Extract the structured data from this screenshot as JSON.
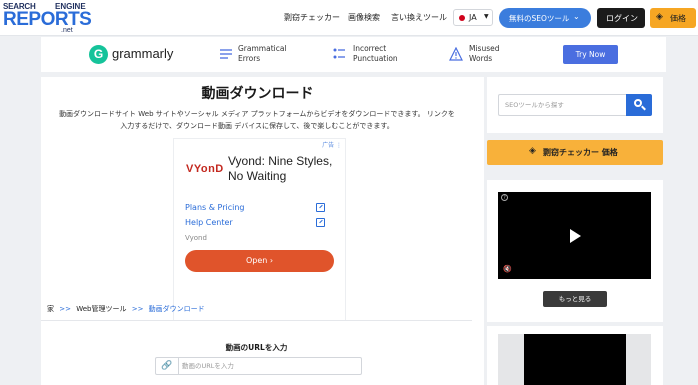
{
  "header": {
    "logo": {
      "line1": "SEARCH",
      "line1b": "ENGINE",
      "line2": "REPORTS",
      "line3": ".net"
    },
    "nav": [
      "剽窃チェッカー",
      "画像検索",
      "言い換えツール"
    ],
    "lang": "JA",
    "seo_tools": "無料のSEOツール",
    "login": "ログイン",
    "pricing": "価格"
  },
  "grammarly": {
    "brand": "grammarly",
    "brand_letter": "G",
    "features": [
      {
        "line1": "Grammatical",
        "line2": "Errors",
        "icon": "list-lines-icon"
      },
      {
        "line1": "Incorrect",
        "line2": "Punctuation",
        "icon": "punctuation-icon"
      },
      {
        "line1": "Misused",
        "line2": "Words",
        "icon": "warning-triangle-icon"
      }
    ],
    "cta": "Try Now"
  },
  "main": {
    "title": "動画ダウンロード",
    "description_line1": "動画ダウンロードサイト Web サイトやソーシャル メディア プラットフォームからビデオをダウンロードできます。 リンクを",
    "description_line2": "入力するだけで、ダウンロード動画 デバイスに保存して、後で楽しむことができます。"
  },
  "ad": {
    "tag": "广告 ⋮",
    "logo": "VYonD",
    "headline": "Vyond: Nine Styles, No Waiting",
    "links": [
      "Plans & Pricing",
      "Help Center"
    ],
    "brand": "Vyond",
    "open": "Open  ›"
  },
  "breadcrumb": {
    "home": "家",
    "sep": ">>",
    "tools": "Web管理ツール",
    "current": "動画ダウンロード"
  },
  "url_form": {
    "label": "動画のURLを入力",
    "placeholder": "動画のURLを入力"
  },
  "sidebar": {
    "search_placeholder": "SEOツールから探す",
    "checker": "剽窃チェッカー 価格",
    "more": "もっと見る"
  },
  "colors": {
    "accent_blue": "#2a6cd8",
    "orange": "#f6a623",
    "grammarly_green": "#15c39a",
    "ad_open": "#e0542b"
  }
}
